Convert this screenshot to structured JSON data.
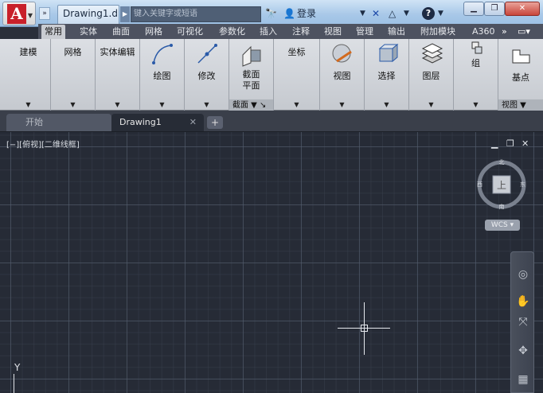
{
  "titlebar": {
    "doc_title": "Drawing1.d...",
    "search_placeholder": "键入关键字或短语",
    "login": "登录",
    "help": "?"
  },
  "tabs": [
    "常用",
    "实体",
    "曲面",
    "网格",
    "可视化",
    "参数化",
    "插入",
    "注释",
    "视图",
    "管理",
    "输出",
    "附加模块",
    "A360"
  ],
  "active_tab": "常用",
  "ribbon_panels": [
    {
      "label": "建模"
    },
    {
      "label": "网格"
    },
    {
      "label": "实体编辑"
    },
    {
      "label": "绘图"
    },
    {
      "label": "修改"
    },
    {
      "label": "截面\n平面",
      "footer": "截面"
    },
    {
      "label": "坐标"
    },
    {
      "label": "视图"
    },
    {
      "label": "选择"
    },
    {
      "label": "图层"
    },
    {
      "label": "组"
    },
    {
      "label": "基点",
      "footer": "视图"
    }
  ],
  "doc_tabs": {
    "start": "开始",
    "drawing": "Drawing1",
    "add": "+"
  },
  "viewport": {
    "label": "[−][俯视][二维线框]",
    "viewcube": {
      "top": "上",
      "north": "北",
      "south": "南",
      "east": "东",
      "west": "西"
    },
    "wcs": "WCS"
  },
  "ucs": {
    "y": "Y"
  }
}
